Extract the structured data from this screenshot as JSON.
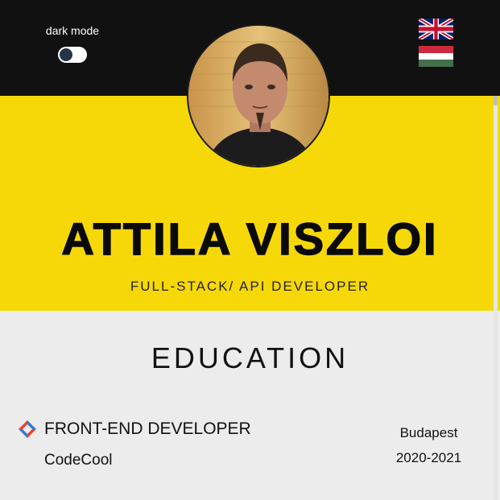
{
  "header": {
    "dark_mode_label": "dark mode",
    "dark_mode_on": false,
    "languages": [
      {
        "code": "en",
        "icon": "uk-flag-icon"
      },
      {
        "code": "hu",
        "icon": "hungary-flag-icon"
      }
    ]
  },
  "profile": {
    "name": "ATTILA VISZLOI",
    "role": "FULL-STACK/ API DEVELOPER",
    "avatar_icon": "profile-photo"
  },
  "education": {
    "section_title": "EDUCATION",
    "items": [
      {
        "title": "FRONT-END DEVELOPER",
        "school": "CodeCool",
        "city": "Budapest",
        "years": "2020-2021",
        "icon": "codecool-logo-icon"
      }
    ]
  },
  "colors": {
    "header_bg": "#111111",
    "accent_yellow": "#f6d808",
    "content_bg": "#ececec",
    "text": "#111111"
  }
}
